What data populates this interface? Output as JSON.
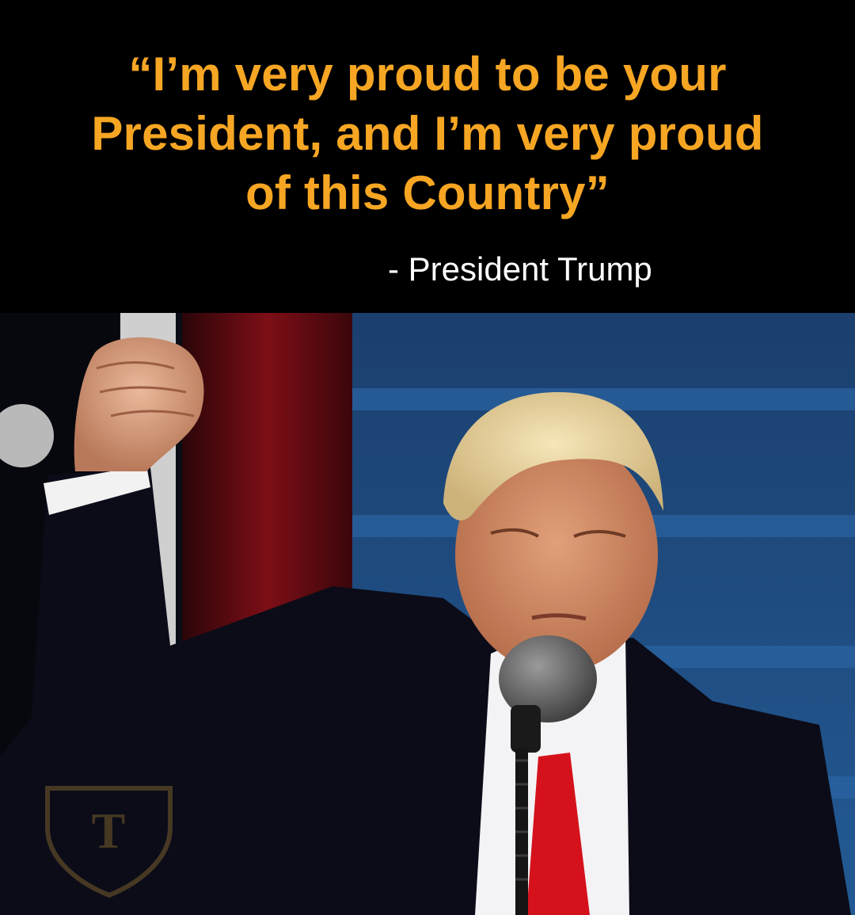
{
  "quote": {
    "lines": [
      "“I’m very proud to be your",
      "President, and I’m very proud",
      "of this Country”"
    ],
    "attribution": "- President Trump",
    "color": "#f6a623"
  },
  "photo": {
    "watermark_letter": "T"
  },
  "colors": {
    "background": "#000000",
    "quote_text": "#f6a623",
    "attribution_text": "#ffffff",
    "tie": "#d5121c",
    "steps_blue": "#1f4f86"
  }
}
